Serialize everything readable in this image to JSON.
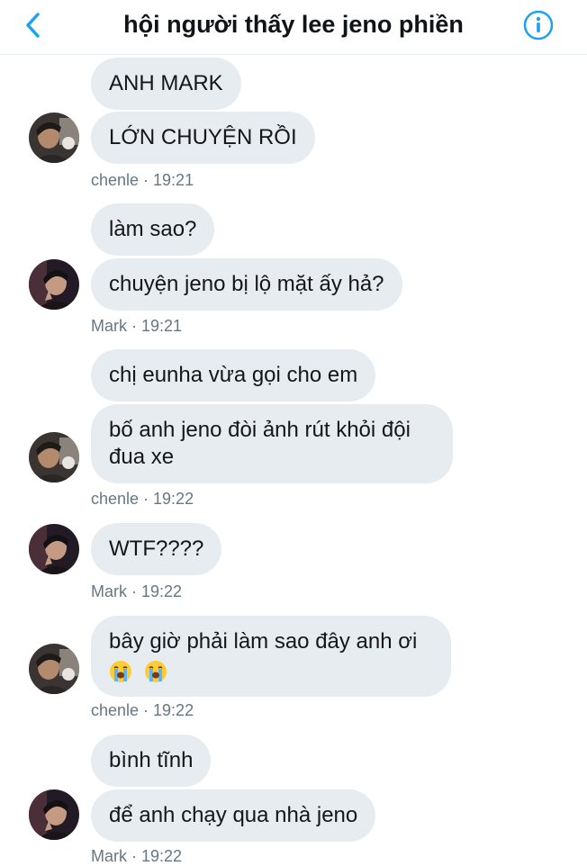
{
  "header": {
    "title": "hội người thấy lee jeno phiền",
    "back_icon": "chevron-left-icon",
    "info_icon": "info-icon",
    "accent_color": "#1da1f2"
  },
  "messages": [
    {
      "text": "ANH MARK"
    },
    {
      "text": "LỚN CHUYỆN RỒI"
    },
    {
      "meta": "chenle · 19:21"
    },
    {
      "text": "làm sao?"
    },
    {
      "text": "chuyện jeno bị lộ mặt ấy hả?"
    },
    {
      "meta": "Mark  · 19:21"
    },
    {
      "text": "chị eunha vừa gọi cho em"
    },
    {
      "text": "bố anh jeno đòi ảnh rút khỏi đội đua xe"
    },
    {
      "meta": "chenle · 19:22"
    },
    {
      "text": "WTF????"
    },
    {
      "meta": "Mark  · 19:22"
    },
    {
      "text": "bây giờ phải làm sao đây anh ơi",
      "emoji": "loudly-crying-face-icon"
    },
    {
      "meta": "chenle · 19:22"
    },
    {
      "text": "bình tĩnh"
    },
    {
      "text": "để anh chạy qua nhà jeno"
    },
    {
      "meta": "Mark  · 19:22"
    }
  ],
  "bubble_color": "#e6ecf0",
  "meta_color": "#657786"
}
